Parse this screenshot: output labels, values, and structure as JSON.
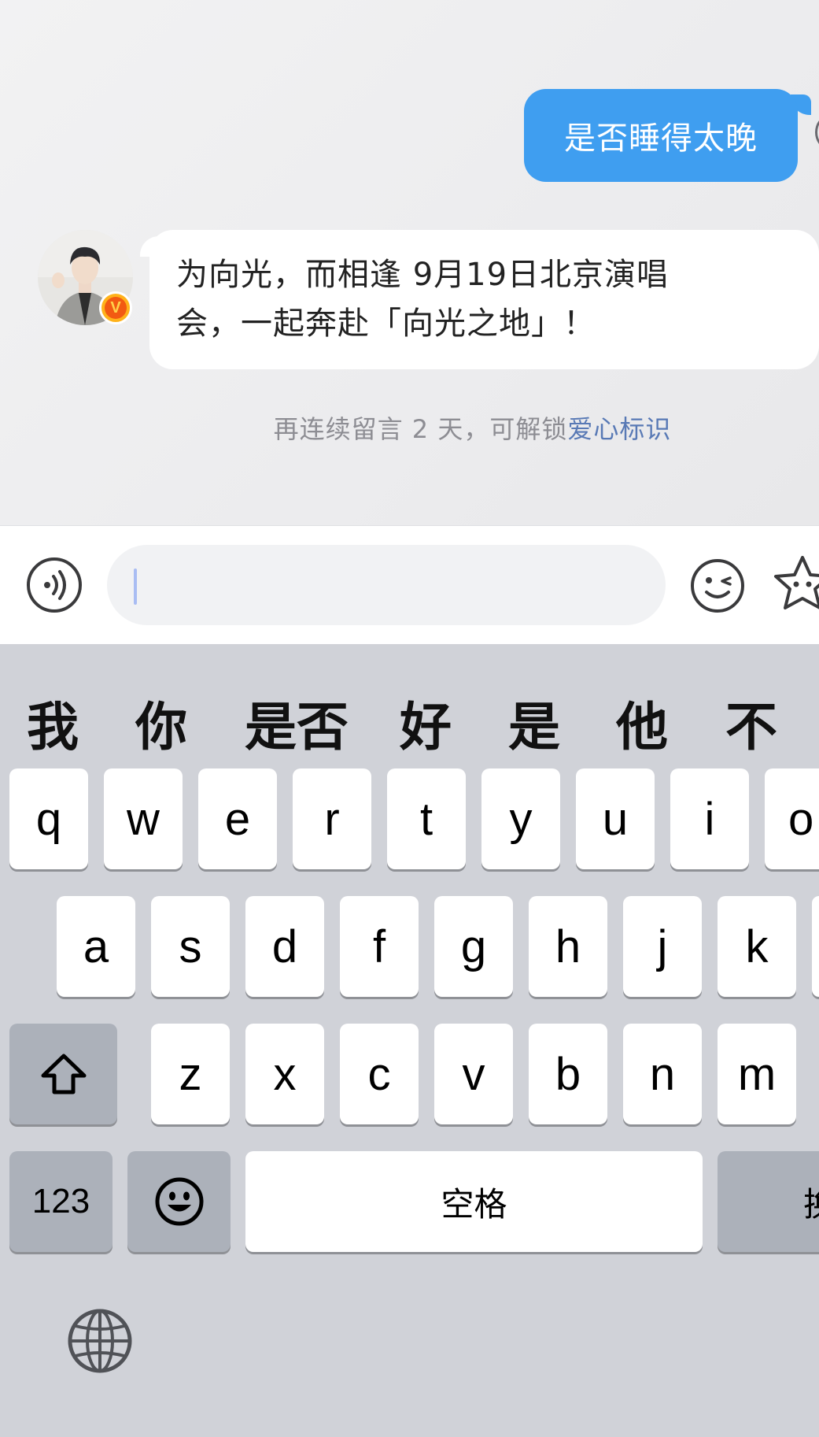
{
  "chat": {
    "outgoing": {
      "text": "是否睡得太晚"
    },
    "incoming": {
      "line1": "为向光，而相逢 9月19日北京演唱",
      "line2": "会，一起奔赴「向光之地」！",
      "badge": "V"
    },
    "hint": {
      "prefix": "再连续留言 2 天，可解锁",
      "link": "爱心标识"
    }
  },
  "input_bar": {
    "voice_icon": "voice-wave-icon",
    "text_value": "",
    "emoji_icon": "wink-face-icon",
    "sticker_icon": "star-sticker-icon"
  },
  "keyboard": {
    "candidates": [
      "我",
      "你",
      "是否",
      "好",
      "是",
      "他",
      "不"
    ],
    "row1": [
      "q",
      "w",
      "e",
      "r",
      "t",
      "y",
      "u",
      "i",
      "o"
    ],
    "row2": [
      "a",
      "s",
      "d",
      "f",
      "g",
      "h",
      "j",
      "k"
    ],
    "row3": [
      "z",
      "x",
      "c",
      "v",
      "b",
      "n",
      "m"
    ],
    "shift_icon": "shift-arrow-icon",
    "numbers_label": "123",
    "emoji_key_icon": "smiley-face-icon",
    "space_label": "空格",
    "return_label": "换",
    "globe_icon": "globe-icon"
  },
  "colors": {
    "outgoing_bubble": "#3f9ef0",
    "keyboard_bg": "#d0d2d8",
    "hint_link": "#5879b5"
  }
}
